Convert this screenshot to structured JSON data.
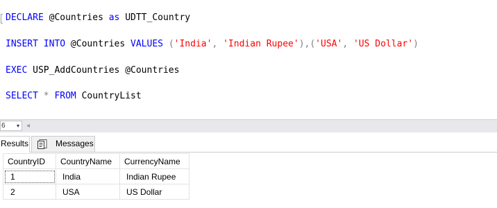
{
  "editor": {
    "lines": [
      [
        {
          "t": "DECLARE",
          "c": "kw"
        },
        {
          "t": " @Countries ",
          "c": "txt"
        },
        {
          "t": "as",
          "c": "kw"
        },
        {
          "t": " UDTT_Country",
          "c": "txt"
        }
      ],
      [
        {
          "t": "INSERT",
          "c": "kw"
        },
        {
          "t": " ",
          "c": "txt"
        },
        {
          "t": "INTO",
          "c": "kw"
        },
        {
          "t": " @Countries ",
          "c": "txt"
        },
        {
          "t": "VALUES",
          "c": "kw"
        },
        {
          "t": " (",
          "c": "op"
        },
        {
          "t": "'India'",
          "c": "str"
        },
        {
          "t": ", ",
          "c": "op"
        },
        {
          "t": "'Indian Rupee'",
          "c": "str"
        },
        {
          "t": "),(",
          "c": "op"
        },
        {
          "t": "'USA'",
          "c": "str"
        },
        {
          "t": ", ",
          "c": "op"
        },
        {
          "t": "'US Dollar'",
          "c": "str"
        },
        {
          "t": ")",
          "c": "op"
        }
      ],
      [
        {
          "t": "EXEC",
          "c": "kw"
        },
        {
          "t": " USP_AddCountries @Countries",
          "c": "txt"
        }
      ],
      [
        {
          "t": "SELECT",
          "c": "kw"
        },
        {
          "t": " * ",
          "c": "op"
        },
        {
          "t": "FROM",
          "c": "kw"
        },
        {
          "t": " CountryList",
          "c": "txt"
        }
      ]
    ]
  },
  "statusbar": {
    "zoom_value": "6",
    "zoom_arrow": "▾",
    "scroll_left_arrow": "◂"
  },
  "tabs": {
    "results_label": "Results",
    "messages_label": "Messages"
  },
  "grid": {
    "columns": [
      "CountryID",
      "CountryName",
      "CurrencyName"
    ],
    "rows": [
      [
        "1",
        "India",
        "Indian Rupee"
      ],
      [
        "2",
        "USA",
        "US Dollar"
      ]
    ]
  }
}
